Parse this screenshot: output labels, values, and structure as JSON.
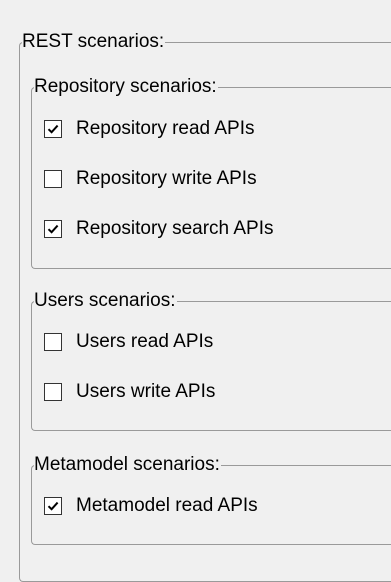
{
  "rest": {
    "title": "REST scenarios:",
    "repository": {
      "title": "Repository scenarios:",
      "items": [
        {
          "label": "Repository read APIs",
          "checked": true
        },
        {
          "label": "Repository write APIs",
          "checked": false
        },
        {
          "label": "Repository search APIs",
          "checked": true
        }
      ]
    },
    "users": {
      "title": "Users scenarios:",
      "items": [
        {
          "label": "Users read APIs",
          "checked": false
        },
        {
          "label": "Users write APIs",
          "checked": false
        }
      ]
    },
    "metamodel": {
      "title": "Metamodel scenarios:",
      "items": [
        {
          "label": "Metamodel read APIs",
          "checked": true
        }
      ]
    }
  }
}
